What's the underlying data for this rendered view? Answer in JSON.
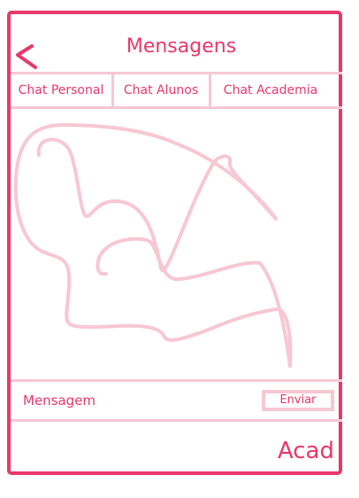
{
  "header": {
    "title": "Mensagens"
  },
  "tabs": [
    {
      "label": "Chat Personal"
    },
    {
      "label": "Chat Alunos"
    },
    {
      "label": "Chat Academia"
    }
  ],
  "composer": {
    "message_label": "Mensagem",
    "send_label": "Enviar"
  },
  "footer": {
    "brand": "Acad"
  },
  "colors": {
    "accent": "#e8386a",
    "light": "#f7c7d3"
  },
  "icons": {
    "back": "back-arrow-icon"
  }
}
